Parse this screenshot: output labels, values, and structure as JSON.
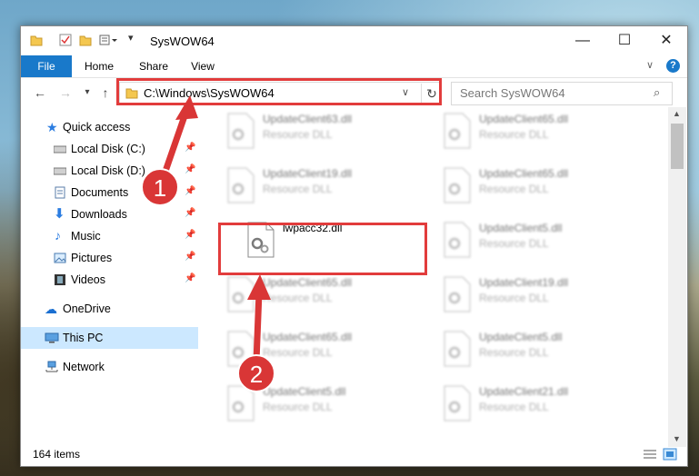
{
  "window": {
    "title": "SysWOW64",
    "minimize_glyph": "—",
    "maximize_glyph": "☐",
    "close_glyph": "✕"
  },
  "ribbon": {
    "tabs": [
      "File",
      "Home",
      "Share",
      "View"
    ],
    "help_glyph": "?"
  },
  "navigation": {
    "address": "C:\\Windows\\SysWOW64",
    "search_placeholder": "Search SysWOW64"
  },
  "sidebar": {
    "quick_access": "Quick access",
    "items": [
      {
        "label": "Local Disk (C:)",
        "icon": "drive-icon"
      },
      {
        "label": "Local Disk (D:)",
        "icon": "drive-icon"
      },
      {
        "label": "Documents",
        "icon": "documents-icon"
      },
      {
        "label": "Downloads",
        "icon": "downloads-icon"
      },
      {
        "label": "Music",
        "icon": "music-icon"
      },
      {
        "label": "Pictures",
        "icon": "pictures-icon"
      },
      {
        "label": "Videos",
        "icon": "videos-icon"
      }
    ],
    "onedrive": "OneDrive",
    "this_pc": "This PC",
    "network": "Network"
  },
  "files": [
    {
      "name": "UpdateClient63.dll",
      "type": "Resource DLL"
    },
    {
      "name": "UpdateClient65.dll",
      "type": "Resource DLL"
    },
    {
      "name": "UpdateClient19.dll",
      "type": "Resource DLL"
    },
    {
      "name": "UpdateClient65.dll",
      "type": "Resource DLL"
    },
    {
      "name": "lwpacc32.dll",
      "type": ""
    },
    {
      "name": "UpdateClient5.dll",
      "type": "Resource DLL"
    },
    {
      "name": "UpdateClient65.dll",
      "type": "Resource DLL"
    },
    {
      "name": "UpdateClient19.dll",
      "type": "Resource DLL"
    },
    {
      "name": "UpdateClient65.dll",
      "type": "Resource DLL"
    },
    {
      "name": "UpdateClient5.dll",
      "type": "Resource DLL"
    },
    {
      "name": "UpdateClient5.dll",
      "type": "Resource DLL"
    },
    {
      "name": "UpdateClient21.dll",
      "type": "Resource DLL"
    }
  ],
  "status": {
    "item_count": "164 items"
  },
  "annotations": {
    "step1": "1",
    "step2": "2",
    "highlight_color": "#e23c3c"
  }
}
